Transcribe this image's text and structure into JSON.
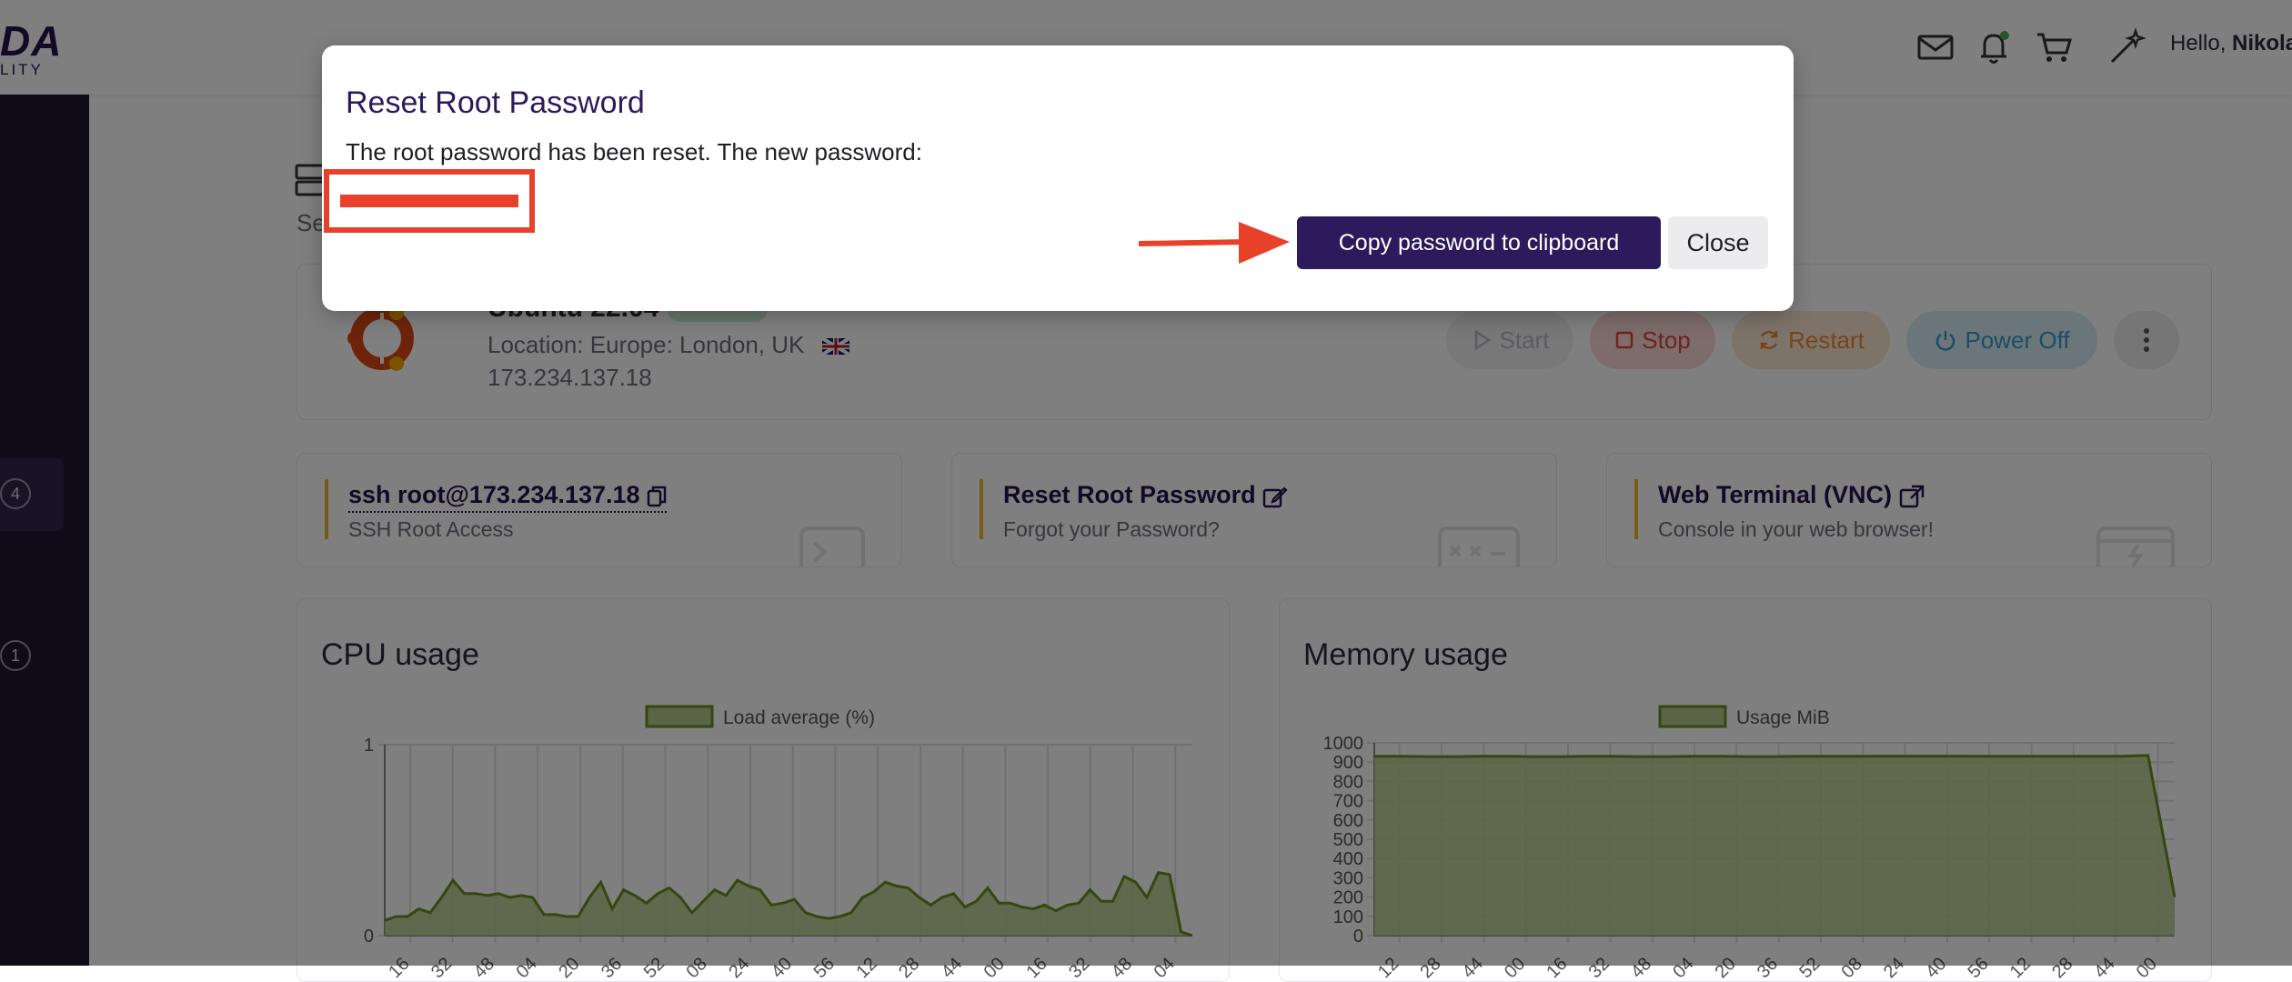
{
  "header": {
    "logo_main": "DA",
    "logo_sub": "LITY",
    "greeting": "Hello,",
    "user_name": "Nikola",
    "icons": [
      "mail-icon",
      "bell-icon",
      "cart-icon",
      "magic-wand-icon"
    ],
    "notification_dot_color": "#4caf50"
  },
  "sidebar": {
    "badges": [
      "4",
      "1"
    ]
  },
  "content": {
    "tab_label": "Se",
    "server": {
      "os_name": "Ubuntu 22.04",
      "location": "Location: Europe: London, UK",
      "ip": "173.234.137.18"
    },
    "actions": {
      "start": "Start",
      "stop": "Stop",
      "restart": "Restart",
      "power_off": "Power Off"
    },
    "cards": [
      {
        "title": "ssh root@173.234.137.18",
        "subtitle": "SSH Root Access"
      },
      {
        "title": "Reset Root Password",
        "subtitle": "Forgot your Password?"
      },
      {
        "title": "Web Terminal (VNC)",
        "subtitle": "Console in your web browser!"
      }
    ]
  },
  "charts": {
    "cpu_title": "CPU usage",
    "memory_title": "Memory usage"
  },
  "chart_data": [
    {
      "type": "area",
      "title": "CPU usage",
      "legend": "Load average (%)",
      "ylim": [
        0,
        1
      ],
      "yticks": [
        "0",
        "1"
      ],
      "xticks": [
        "16",
        "32",
        "48",
        "04",
        "20",
        "36",
        "52",
        "08",
        "24",
        "40",
        "56",
        "12",
        "28",
        "44",
        "00",
        "16",
        "32",
        "48",
        "04"
      ],
      "values": [
        0.08,
        0.1,
        0.1,
        0.14,
        0.12,
        0.2,
        0.29,
        0.22,
        0.22,
        0.21,
        0.22,
        0.2,
        0.21,
        0.2,
        0.11,
        0.11,
        0.1,
        0.1,
        0.2,
        0.28,
        0.14,
        0.24,
        0.21,
        0.17,
        0.22,
        0.25,
        0.2,
        0.12,
        0.18,
        0.24,
        0.21,
        0.29,
        0.26,
        0.24,
        0.16,
        0.17,
        0.19,
        0.12,
        0.1,
        0.09,
        0.1,
        0.12,
        0.2,
        0.23,
        0.28,
        0.26,
        0.25,
        0.2,
        0.16,
        0.2,
        0.22,
        0.15,
        0.18,
        0.25,
        0.17,
        0.17,
        0.15,
        0.14,
        0.16,
        0.13,
        0.16,
        0.17,
        0.24,
        0.18,
        0.18,
        0.31,
        0.28,
        0.2,
        0.33,
        0.32,
        0.02,
        0.0
      ],
      "color": "#6b8e23"
    },
    {
      "type": "area",
      "title": "Memory usage",
      "legend": "Usage MiB",
      "ylim": [
        0,
        1000
      ],
      "yticks": [
        "0",
        "100",
        "200",
        "300",
        "400",
        "500",
        "600",
        "700",
        "800",
        "900",
        "1000"
      ],
      "xticks": [
        "12",
        "28",
        "44",
        "00",
        "16",
        "32",
        "48",
        "04",
        "20",
        "36",
        "52",
        "08",
        "24",
        "40",
        "56",
        "12",
        "28",
        "44",
        "00"
      ],
      "values": [
        930,
        930,
        929,
        929,
        930,
        930,
        929,
        929,
        930,
        930,
        929,
        929,
        930,
        930,
        929,
        929,
        930,
        930,
        930,
        931,
        931,
        931,
        931,
        930,
        930,
        930,
        930,
        930,
        930,
        935,
        200
      ],
      "color": "#6b8e23"
    }
  ],
  "modal": {
    "title": "Reset Root Password",
    "message": "The root password has been reset. The new password:",
    "copy_label": "Copy password to clipboard",
    "close_label": "Close",
    "highlight_color": "#e8412a"
  }
}
